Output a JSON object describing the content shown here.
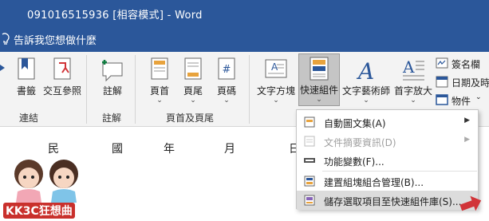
{
  "window": {
    "title": "091016515936 [相容模式] - Word"
  },
  "tellme": {
    "text": "告訴我您想做什麼"
  },
  "ribbon": {
    "buttons": {
      "bookmark": "書籤",
      "crossref": "交互參照",
      "comment": "註解",
      "header": "頁首",
      "footer": "頁尾",
      "pagenum": "頁碼",
      "textbox": "文字方塊",
      "quickparts": "快速組件",
      "wordart": "文字藝術師",
      "dropcap": "首字放大"
    },
    "small_buttons": {
      "signature": "簽名欄",
      "datetime": "日期及時",
      "object": "物件"
    },
    "chevron": "⌄",
    "groups": {
      "links": "連結",
      "comments": "註解",
      "header_footer": "頁首及頁尾"
    }
  },
  "document": {
    "chars": [
      "民",
      "國",
      "年",
      "月",
      "日"
    ]
  },
  "quickparts_menu": {
    "items": [
      {
        "label": "自動圖文集(A)",
        "submenu": "▶",
        "disabled": false
      },
      {
        "label": "文件摘要資訊(D)",
        "submenu": "▶",
        "disabled": true
      },
      {
        "label": "功能變數(F)...",
        "disabled": false
      },
      {
        "label": "建置組塊組合管理(B)...",
        "disabled": false
      },
      {
        "label": "儲存選取項目至快速組件庫(S)...",
        "disabled": false
      }
    ]
  },
  "watermark": {
    "text": "KK3C狂想曲"
  },
  "colors": {
    "word_blue": "#2b579a",
    "accent": "#d13438",
    "ribbon_bg": "#f3f3f3"
  }
}
